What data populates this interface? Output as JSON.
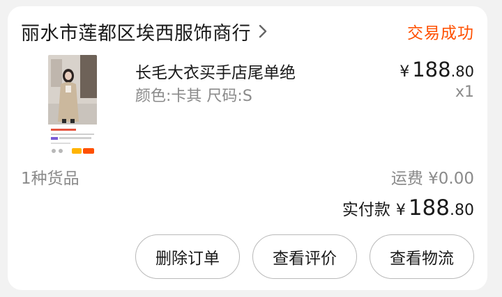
{
  "order": {
    "shop_name": "丽水市莲都区埃西服饰商行",
    "status": "交易成功",
    "item": {
      "title": "长毛大衣买手店尾单绝",
      "spec": "颜色:卡其 尺码:S",
      "price_symbol": "¥",
      "price_int": "188",
      "price_dec": ".80",
      "quantity": "x1",
      "thumbnail_icon": "product-photo-icon"
    },
    "item_count": "1种货品",
    "shipping": "运费 ¥0.00",
    "paid_label": "实付款",
    "paid_symbol": "¥",
    "paid_int": "188",
    "paid_dec": ".80",
    "actions": [
      {
        "label": "删除订单"
      },
      {
        "label": "查看评价"
      },
      {
        "label": "查看物流"
      }
    ]
  },
  "colors": {
    "accent": "#ff5000",
    "muted_text": "#8a8a8a",
    "background": "#f2f2f2",
    "card": "#ffffff"
  }
}
